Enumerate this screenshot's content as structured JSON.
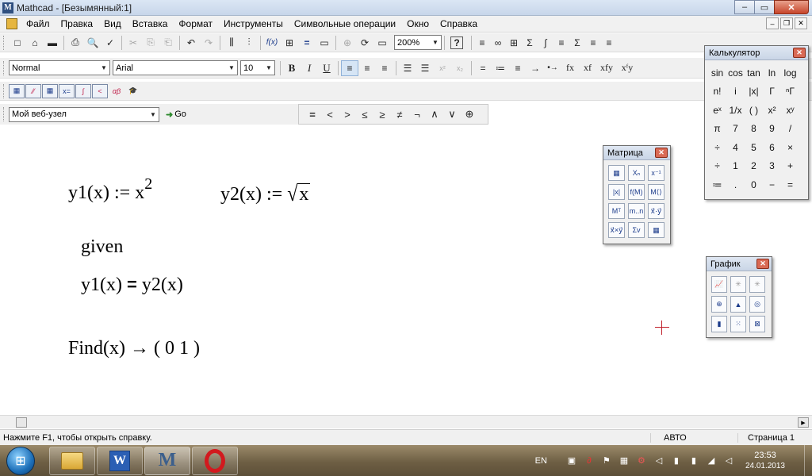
{
  "window": {
    "title": "Mathcad - [Безымянный:1]",
    "min_glyph": "–",
    "max_glyph": "▭",
    "close_glyph": "✕"
  },
  "menu": {
    "items": [
      "Файл",
      "Правка",
      "Вид",
      "Вставка",
      "Формат",
      "Инструменты",
      "Символьные операции",
      "Окно",
      "Справка"
    ],
    "doc_min": "–",
    "doc_restore": "❐",
    "doc_close": "✕"
  },
  "standard_toolbar": {
    "buttons": [
      "□",
      "⌂",
      "▬",
      "⎙",
      "🔍",
      "✓",
      "✂",
      "⎘",
      "⎗",
      "↶",
      "↷",
      "⫼",
      "⫶",
      "f(x)",
      "⊞",
      "=",
      "▭",
      "⊕",
      "⟳"
    ],
    "zoom_value": "200%",
    "help": "?",
    "math_symbols": [
      "≡",
      "∞",
      "⊞",
      "Σ",
      "∫",
      "≡",
      "Σ",
      "≡",
      "≡"
    ]
  },
  "format_toolbar": {
    "style_value": "Normal",
    "font_value": "Arial",
    "size_value": "10",
    "bold": "B",
    "italic": "I",
    "underline": "U",
    "align_icons": [
      "≡",
      "≡",
      "≡"
    ],
    "list_icons": [
      "☰",
      "☰"
    ],
    "subsup": [
      "x²",
      "x₂"
    ],
    "eval_ops": [
      "=",
      "≔",
      "≡",
      "→",
      "•→",
      "fx",
      "xf",
      "xfy",
      "xᶠy"
    ]
  },
  "math_toolbar": {
    "buttons": [
      "▦",
      "⁄⁄",
      "▦",
      "x=",
      "∫",
      "<",
      "αβ",
      "🎓"
    ]
  },
  "web_toolbar": {
    "url_value": "Мой веб-узел",
    "go_label": "Go"
  },
  "bool_toolbar": {
    "ops": [
      "=",
      "<",
      ">",
      "≤",
      "≥",
      "≠",
      "¬",
      "∧",
      "∨",
      "⊕"
    ]
  },
  "worksheet": {
    "y1_def_lhs": "y1(x) :=  x",
    "y1_def_exp": "2",
    "y2_def_lhs": "y2(x) := ",
    "y2_sqrt_sign": "√",
    "y2_sqrt_arg": "x",
    "given": "given",
    "eq_lhs": "y1(x) ",
    "eq_op": "=",
    "eq_rhs": " y2(x)",
    "find": "Find(x) → ( 0   1 )"
  },
  "scrollbar": {
    "right_arrow": "▶"
  },
  "status": {
    "help_text": "Нажмите F1, чтобы открыть справку.",
    "mode": "АВТО",
    "page": "Страница 1"
  },
  "taskbar": {
    "start_glyph": "⊞",
    "word_letter": "W",
    "mathcad_letter": "M",
    "lang": "EN",
    "tray_icons": [
      "▣",
      "∂",
      "⚑",
      "▦",
      "⚙",
      "◁",
      "▮",
      "▮",
      "◢",
      "◁"
    ],
    "time": "23:53",
    "date": "24.01.2013"
  },
  "calculator_palette": {
    "title": "Калькулятор",
    "close": "✕",
    "keys": [
      "sin",
      "cos",
      "tan",
      "ln",
      "log",
      "n!",
      "i",
      "|x|",
      "Γ",
      "ⁿΓ",
      "eˣ",
      "1/x",
      "( )",
      "x²",
      "xʸ",
      "π",
      "7",
      "8",
      "9",
      "/",
      "÷",
      "4",
      "5",
      "6",
      "×",
      "÷",
      "1",
      "2",
      "3",
      "+",
      "≔",
      ".",
      "0",
      "−",
      "="
    ]
  },
  "matrix_palette": {
    "title": "Матрица",
    "close": "✕",
    "keys": [
      "▦",
      "Xₙ",
      "x⁻¹",
      "|x|",
      "f(M)",
      "M⟨⟩",
      "Mᵀ",
      "m..n",
      "x⃗·y⃗",
      "x⃗×y⃗",
      "Σv",
      "▦"
    ]
  },
  "graph_palette": {
    "title": "График",
    "close": "✕",
    "keys": [
      "📈",
      "✳",
      "✳",
      "⊕",
      "▲",
      "◎",
      "▮",
      "⁙",
      "⊠"
    ]
  }
}
